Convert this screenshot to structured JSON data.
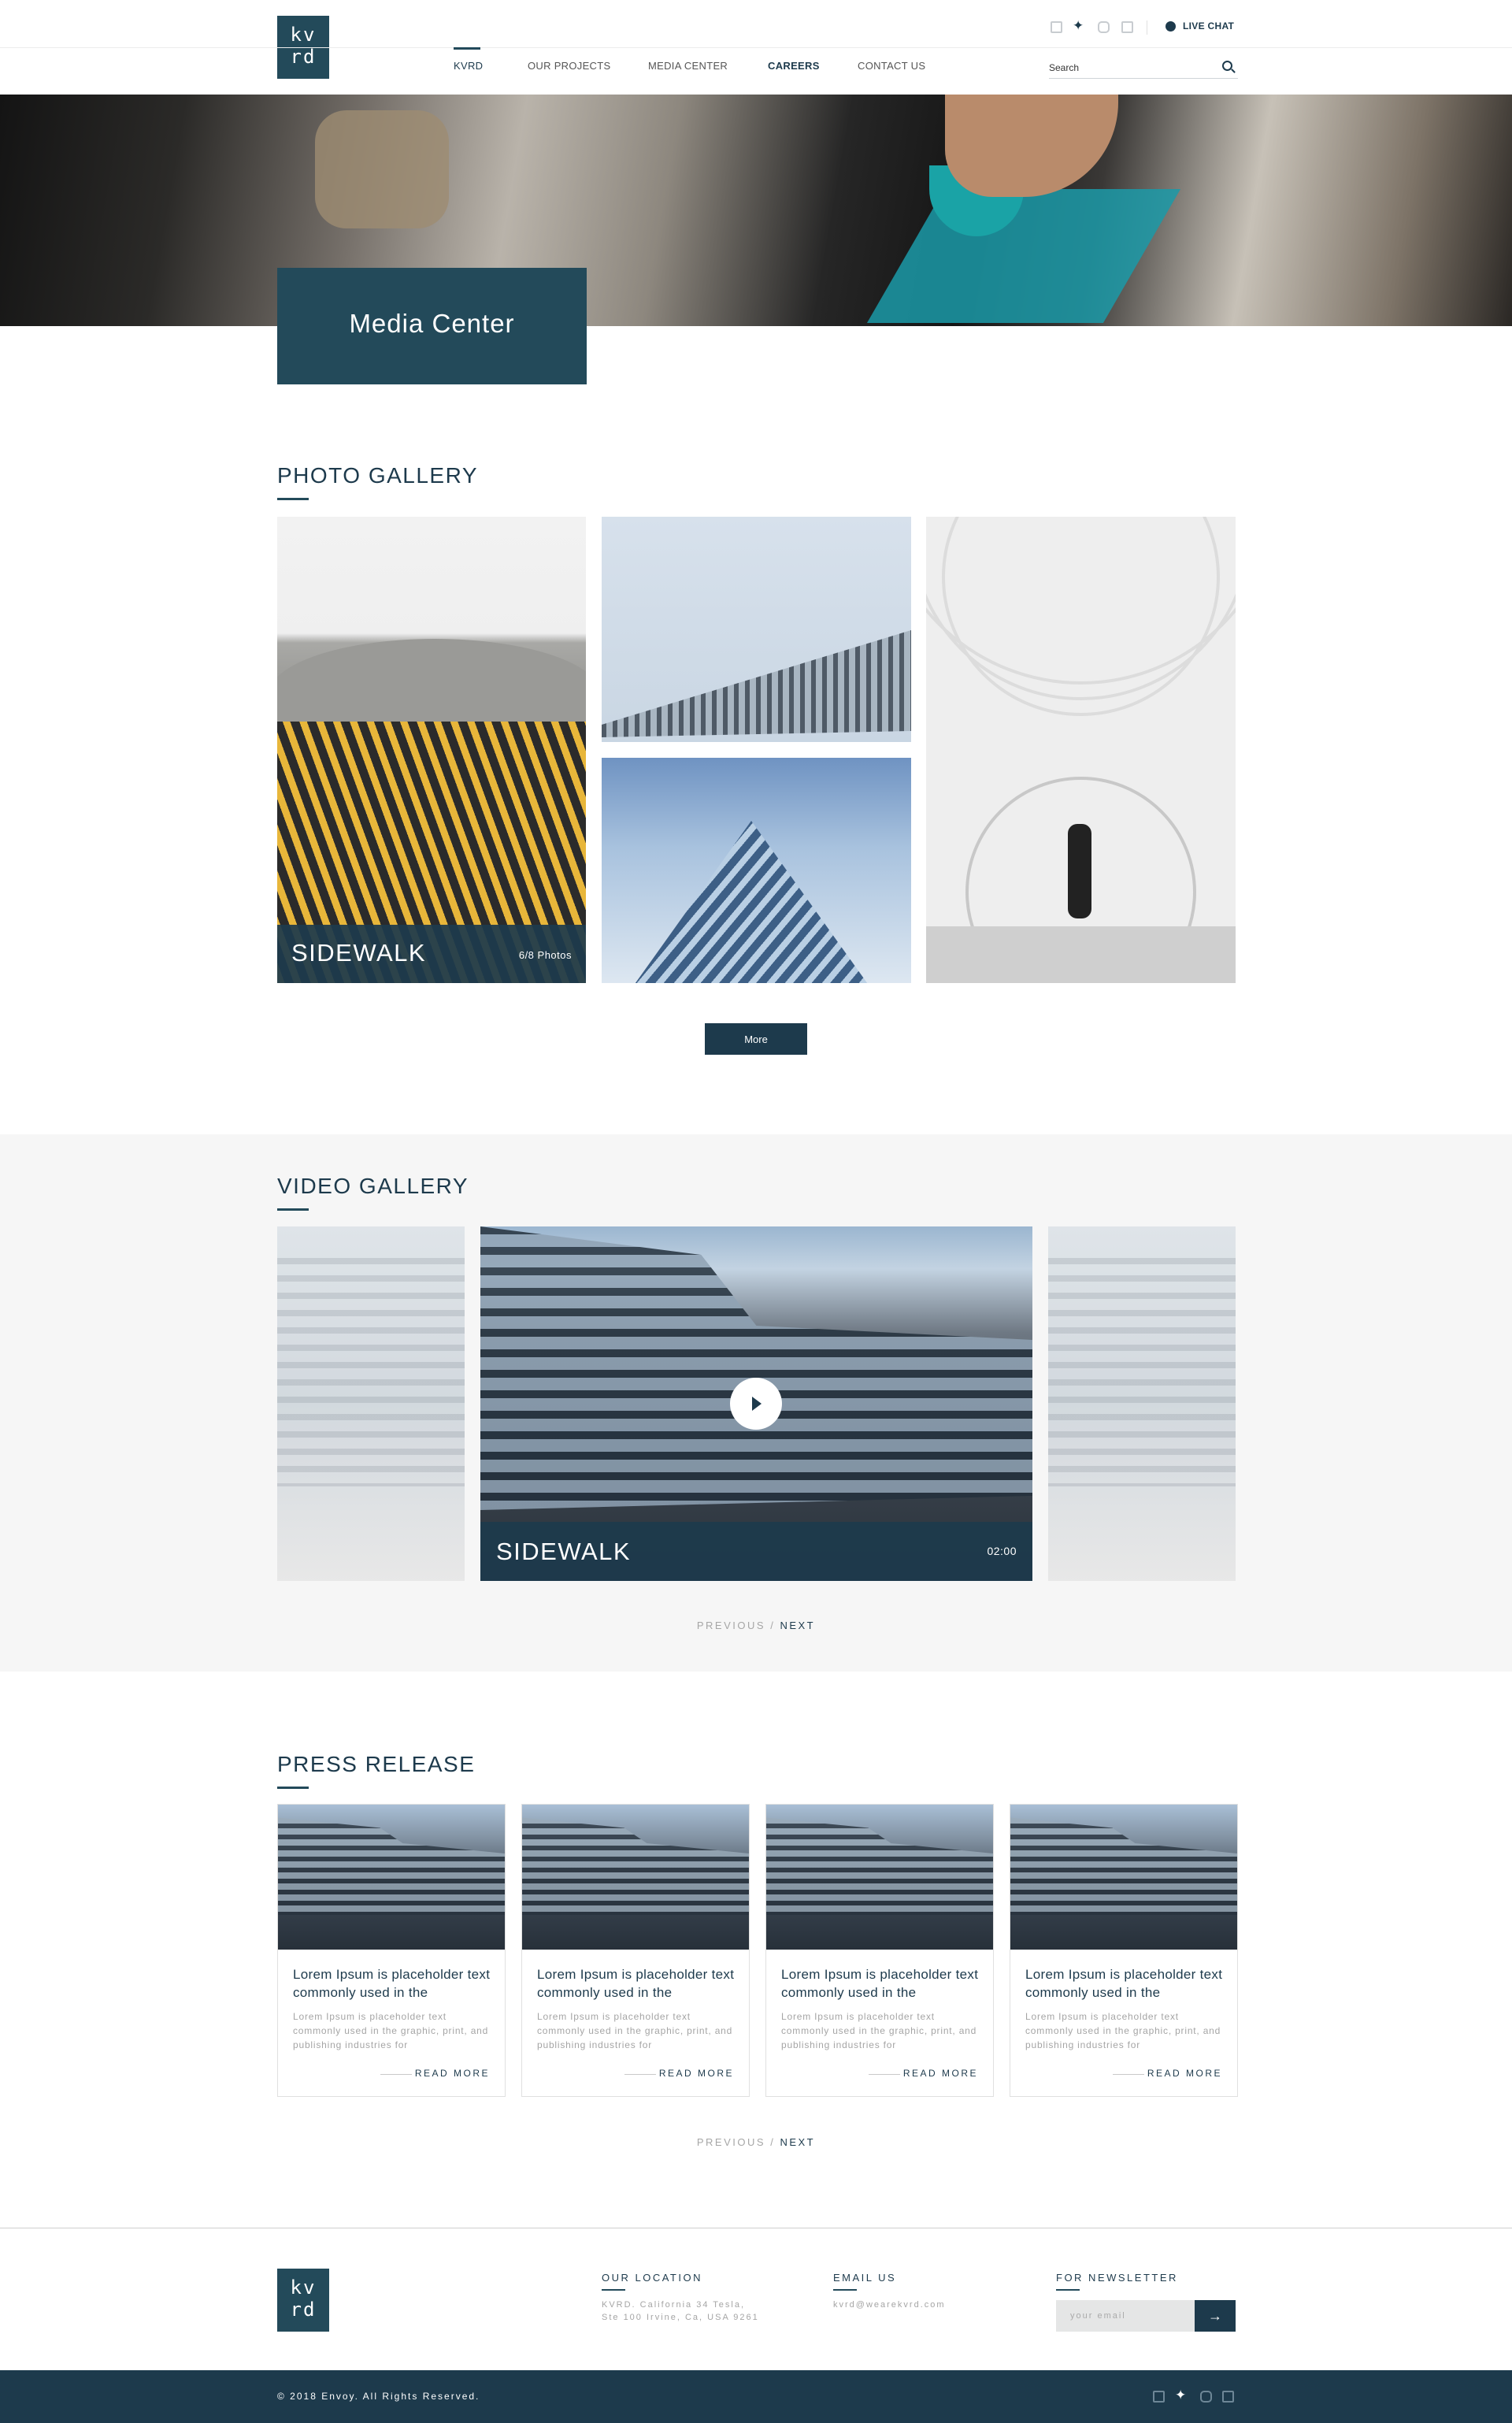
{
  "header": {
    "logo_line1": "kv",
    "logo_line2": "rd",
    "nav": [
      {
        "label": "KVRD"
      },
      {
        "label": "OUR PROJECTS"
      },
      {
        "label": "MEDIA CENTER"
      },
      {
        "label": "CAREERS"
      },
      {
        "label": "CONTACT US"
      }
    ],
    "live_chat": "LIVE CHAT",
    "search_placeholder": "Search",
    "social_icons": [
      "facebook-icon",
      "twitter-icon",
      "instagram-icon",
      "linkedin-icon"
    ]
  },
  "hero": {
    "title": "Media Center"
  },
  "photo_gallery": {
    "title": "PHOTO GALLERY",
    "featured_caption": "SIDEWALK",
    "featured_count": "6/8 Photos",
    "more_label": "More"
  },
  "video_gallery": {
    "title": "VIDEO GALLERY",
    "caption": "SIDEWALK",
    "duration": "02:00",
    "previous": "PREVIOUS",
    "separator": "/",
    "next": "NEXT"
  },
  "press_release": {
    "title": "PRESS RELEASE",
    "cards": [
      {
        "title": "Lorem Ipsum is placeholder text commonly used in the",
        "body": "Lorem Ipsum is placeholder text commonly used in the graphic, print, and publishing industries for",
        "read_more": "READ MORE"
      },
      {
        "title": "Lorem Ipsum is placeholder text commonly used in the",
        "body": "Lorem Ipsum is placeholder text commonly used in the graphic, print, and publishing industries for",
        "read_more": "READ MORE"
      },
      {
        "title": "Lorem Ipsum is placeholder text commonly used in the",
        "body": "Lorem Ipsum is placeholder text commonly used in the graphic, print, and publishing industries for",
        "read_more": "READ MORE"
      },
      {
        "title": "Lorem Ipsum is placeholder text commonly used in the",
        "body": "Lorem Ipsum is placeholder text commonly used in the graphic, print, and publishing industries for",
        "read_more": "READ MORE"
      }
    ],
    "previous": "PREVIOUS",
    "separator": "/",
    "next": "NEXT"
  },
  "footer": {
    "logo_line1": "kv",
    "logo_line2": "rd",
    "location_title": "OUR LOCATION",
    "location_line1": "KVRD. California 34 Tesla,",
    "location_line2": "Ste 100 Irvine, Ca, USA 9261",
    "email_title": "EMAIL US",
    "email": "kvrd@wearekvrd.com",
    "newsletter_title": "FOR NEWSLETTER",
    "newsletter_placeholder": "your email",
    "newsletter_submit": "→",
    "copyright": "© 2018 Envoy. All Rights Reserved."
  },
  "colors": {
    "brand": "#1d3a4c",
    "brand_box": "#234a5a",
    "section_bg": "#f6f6f6",
    "muted_text": "#a5a5a5"
  }
}
